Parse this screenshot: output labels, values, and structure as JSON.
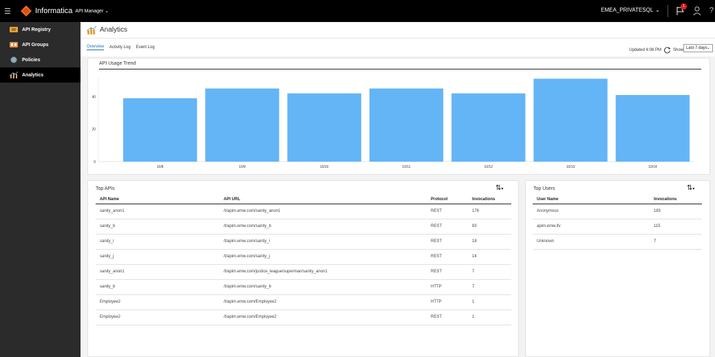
{
  "header": {
    "brand": "Informatica",
    "product": "API Manager",
    "org": "EMEA_PRIVATESQL",
    "notification_count": "1",
    "help": "?"
  },
  "sidebar": {
    "items": [
      {
        "label": "API Registry",
        "icon": "registry-icon",
        "color": "#e5a23c",
        "active": false
      },
      {
        "label": "API Groups",
        "icon": "groups-icon",
        "color": "#e58a3c",
        "active": false
      },
      {
        "label": "Policies",
        "icon": "policies-icon",
        "color": "#6aa9e0",
        "active": false
      },
      {
        "label": "Analytics",
        "icon": "analytics-icon",
        "color": "#e5a23c",
        "active": true
      }
    ]
  },
  "page": {
    "title": "Analytics"
  },
  "tabs": [
    {
      "label": "Overview",
      "active": true
    },
    {
      "label": "Activity Log",
      "active": false
    },
    {
      "label": "Event Log",
      "active": false
    }
  ],
  "toolbar": {
    "updated": "Updated 4:06 PM",
    "show_label": "Show",
    "range": "Last 7 days"
  },
  "chart_data": {
    "type": "bar",
    "title": "API Usage Trend",
    "categories": [
      "10/8",
      "10/9",
      "10/10",
      "10/11",
      "10/12",
      "10/13",
      "10/14"
    ],
    "values": [
      39,
      45,
      42,
      45,
      42,
      51,
      41
    ],
    "yticks": [
      0,
      20,
      40
    ],
    "ylim": [
      0,
      55
    ],
    "bar_color": "#64b5f6",
    "grid": false
  },
  "top_apis": {
    "title": "Top APIs",
    "columns": [
      "API Name",
      "API URL",
      "Protocol",
      "Invocations"
    ],
    "rows": [
      [
        "sanity_anon1",
        "/t/apim.emw.com/sanity_anon1",
        "REST",
        "176"
      ],
      [
        "sanity_b",
        "/t/apim.emw.com/sanity_b",
        "REST",
        "83"
      ],
      [
        "sanity_i",
        "/t/apim.emw.com/sanity_i",
        "REST",
        "18"
      ],
      [
        "sanity_j",
        "/t/apim.emw.com/sanity_j",
        "REST",
        "14"
      ],
      [
        "sanity_anon1",
        "/t/apim.emw.com/justice_league/superman/sanity_anon1",
        "REST",
        "7"
      ],
      [
        "sanity_b",
        "/t/apim.emw.com/sanity_b",
        "HTTP",
        "7"
      ],
      [
        "Employee2",
        "/t/apim.emw.com/Employee2",
        "HTTP",
        "1"
      ],
      [
        "Employee2",
        "/t/apim.emw.com/Employee2",
        "REST",
        "1"
      ]
    ]
  },
  "top_users": {
    "title": "Top Users",
    "columns": [
      "User Name",
      "Invocations"
    ],
    "rows": [
      [
        "Anonymous",
        "183"
      ],
      [
        "apim.emw.ifv",
        "115"
      ],
      [
        "Unknown",
        "7"
      ]
    ]
  }
}
